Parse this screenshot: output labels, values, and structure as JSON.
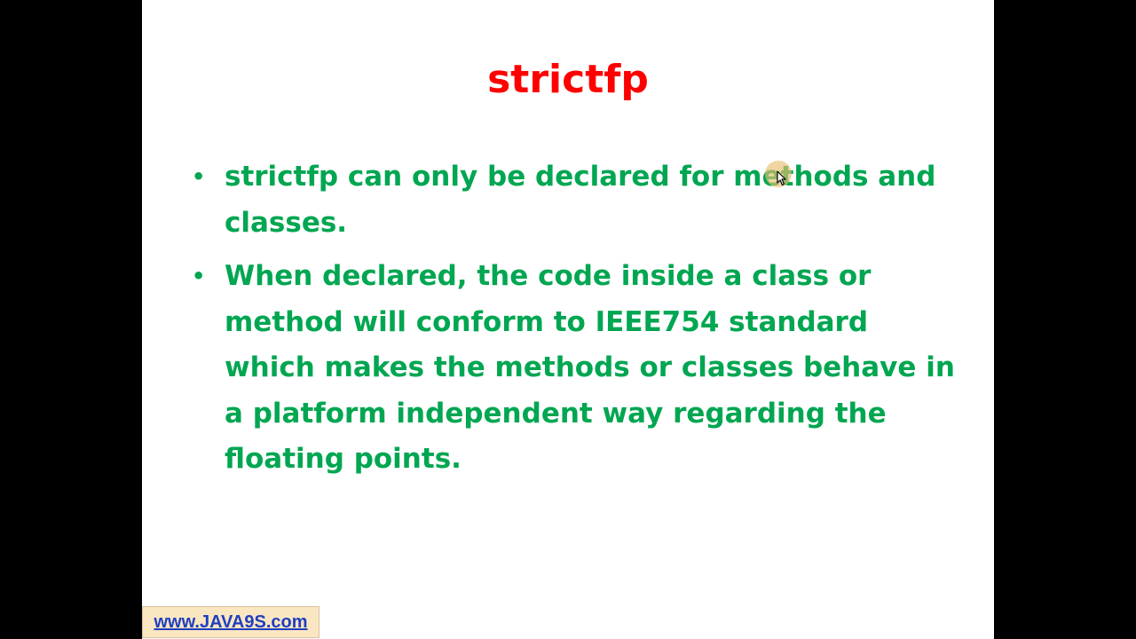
{
  "slide": {
    "title": "strictfp",
    "bullets": [
      {
        "marker": "•",
        "text": "strictfp can only be declared for methods and classes."
      },
      {
        "marker": "•",
        "text": "When declared, the code inside a class or method will conform to IEEE754  standard which makes the methods or classes behave in a platform independent way regarding the floating points."
      }
    ]
  },
  "watermark": {
    "text": "www.JAVA9S.com"
  },
  "icons": {
    "cursor": "mouse-pointer-icon"
  },
  "colors": {
    "background": "#000000",
    "slide_background": "#ffffff",
    "title": "#ff0000",
    "body_text": "#00a651",
    "link": "#1f3fbf",
    "watermark_background": "#fbe6c2"
  }
}
